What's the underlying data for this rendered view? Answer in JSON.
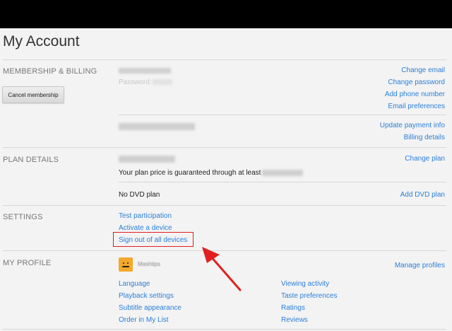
{
  "page": {
    "title": "My Account"
  },
  "membership": {
    "section_title": "MEMBERSHIP & BILLING",
    "cancel_button": "Cancel membership",
    "email_label": "Password:",
    "links": [
      "Change email",
      "Change password",
      "Add phone number",
      "Email preferences"
    ],
    "payment_links": [
      "Update payment info",
      "Billing details"
    ]
  },
  "plan": {
    "section_title": "PLAN DETAILS",
    "change_plan": "Change plan",
    "price_text": "Your plan price is guaranteed through at least",
    "dvd_text": "No DVD plan",
    "add_dvd": "Add DVD plan"
  },
  "settings": {
    "section_title": "SETTINGS",
    "links": [
      "Test participation",
      "Activate a device",
      "Sign out of all devices"
    ]
  },
  "profile": {
    "section_title": "MY PROFILE",
    "name": "Mashtips",
    "manage": "Manage profiles",
    "left_links": [
      "Language",
      "Playback settings",
      "Subtitle appearance",
      "Order in My List"
    ],
    "right_links": [
      "Viewing activity",
      "Taste preferences",
      "Ratings",
      "Reviews"
    ]
  },
  "colors": {
    "link": "#2b7fd8",
    "highlight": "#e02020",
    "avatar": "#f3a92a"
  }
}
